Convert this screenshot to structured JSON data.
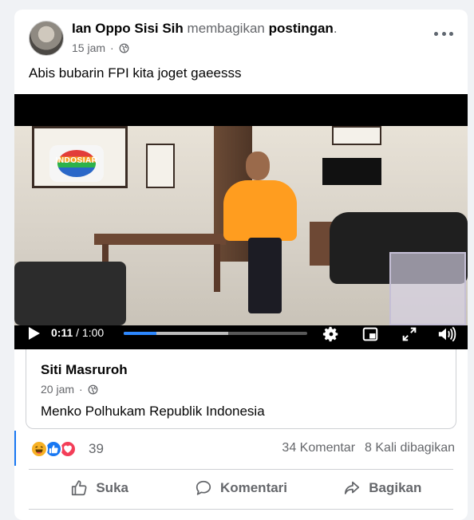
{
  "post": {
    "author_name": "Ian Oppo Sisi Sih",
    "share_verb": "membagikan",
    "share_object": "postingan",
    "period": ".",
    "time": "15 jam",
    "separator": "·",
    "caption": "Abis bubarin FPI kita joget gaeesss",
    "more_icon": "more-horizontal-icon",
    "privacy_icon": "globe-icon"
  },
  "video": {
    "logo_text": "INDOSIAR",
    "current_time": "0:11",
    "duration": " / 1:00",
    "played_fraction": 0.18,
    "buffered_fraction": 0.57,
    "icons": [
      "play-icon",
      "gear-icon",
      "picture-in-picture-icon",
      "fullscreen-icon",
      "volume-icon"
    ]
  },
  "shared_post": {
    "author": "Siti Masruroh",
    "time": "20 jam",
    "separator": "·",
    "text": "Menko Polhukam Republik Indonesia"
  },
  "engagement": {
    "reaction_count": "39",
    "comments": "34 Komentar",
    "shares": "8 Kali dibagikan",
    "reactions": [
      "haha",
      "like",
      "love"
    ]
  },
  "actions": {
    "like": "Suka",
    "comment": "Komentari",
    "share": "Bagikan"
  },
  "colors": {
    "accent": "#1877f2",
    "text_muted": "#65676b",
    "love": "#f33e58",
    "haha": "#f7b125"
  }
}
